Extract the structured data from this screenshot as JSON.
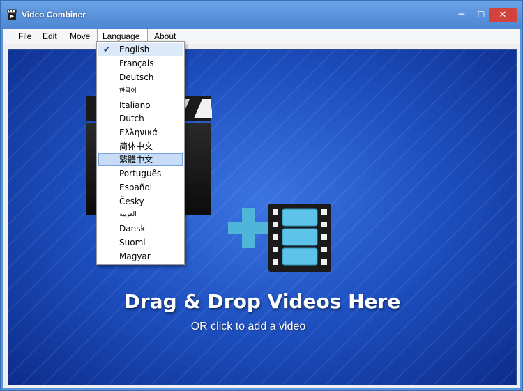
{
  "window": {
    "title": "Video Combiner",
    "icons": {
      "app": "clapperboard-icon",
      "minimize": "minimize-icon",
      "maximize": "maximize-icon",
      "close": "close-icon"
    },
    "glyphs": {
      "minimize": "─",
      "maximize": "☐",
      "close": "✕"
    },
    "colors": {
      "titlebar": "#5b95dc",
      "close_button": "#d2433c"
    }
  },
  "menubar": {
    "items": [
      {
        "label": "File"
      },
      {
        "label": "Edit"
      },
      {
        "label": "Move"
      },
      {
        "label": "Language"
      },
      {
        "label": "About"
      }
    ],
    "open_menu": "Language"
  },
  "language_menu": {
    "items": [
      {
        "label": "English",
        "checked": true
      },
      {
        "label": "Français"
      },
      {
        "label": "Deutsch"
      },
      {
        "label": "한국어"
      },
      {
        "label": "Italiano"
      },
      {
        "label": "Dutch"
      },
      {
        "label": "Ελληνικά"
      },
      {
        "label": "简体中文"
      },
      {
        "label": "繁體中文",
        "highlighted": true
      },
      {
        "label": "Português"
      },
      {
        "label": "Español"
      },
      {
        "label": "Česky"
      },
      {
        "label": "العربية"
      },
      {
        "label": "Dansk"
      },
      {
        "label": "Suomi"
      },
      {
        "label": "Magyar"
      }
    ],
    "check_glyph": "✔"
  },
  "drop_area": {
    "title": "Drag & Drop Videos Here",
    "subtitle": "OR click to add a video",
    "icons": {
      "main": "play-clapperboard-icon",
      "add": "plus-icon",
      "film": "film-strip-icon"
    },
    "colors": {
      "background": "#1d4fbf",
      "plus": "#4fb5d9"
    }
  }
}
